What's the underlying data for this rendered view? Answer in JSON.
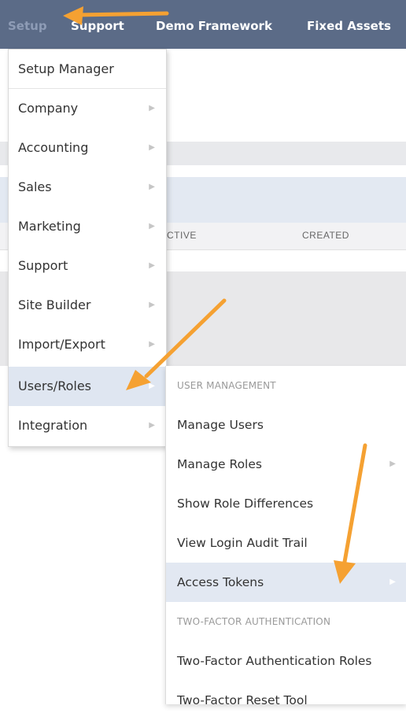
{
  "nav": {
    "items": [
      "Setup",
      "Support",
      "Demo Framework",
      "Fixed Assets"
    ]
  },
  "table": {
    "columns": [
      "CTIVE",
      "CREATED"
    ]
  },
  "menu": {
    "items": [
      {
        "label": "Setup Manager",
        "has_submenu": false
      },
      {
        "label": "Company",
        "has_submenu": true
      },
      {
        "label": "Accounting",
        "has_submenu": true
      },
      {
        "label": "Sales",
        "has_submenu": true
      },
      {
        "label": "Marketing",
        "has_submenu": true
      },
      {
        "label": "Support",
        "has_submenu": true
      },
      {
        "label": "Site Builder",
        "has_submenu": true
      },
      {
        "label": "Import/Export",
        "has_submenu": true
      },
      {
        "label": "Users/Roles",
        "has_submenu": true,
        "active": true
      },
      {
        "label": "Integration",
        "has_submenu": true
      }
    ],
    "arrow_glyph": "▶"
  },
  "submenu": {
    "section_user_management": "USER MANAGEMENT",
    "items": [
      {
        "label": "Manage Users"
      },
      {
        "label": "Manage Roles",
        "has_submenu": true
      },
      {
        "label": "Show Role Differences"
      },
      {
        "label": "View Login Audit Trail"
      },
      {
        "label": "Access Tokens",
        "has_submenu": true,
        "active": true
      }
    ],
    "section_two_factor": "TWO-FACTOR AUTHENTICATION",
    "items2": [
      {
        "label": "Two-Factor Authentication Roles"
      },
      {
        "label": "Two-Factor Reset Tool"
      }
    ]
  },
  "colors": {
    "nav_bg": "#5b6b87",
    "active_bg": "#dfe6f1",
    "annotation_arrow": "#f5a132"
  }
}
